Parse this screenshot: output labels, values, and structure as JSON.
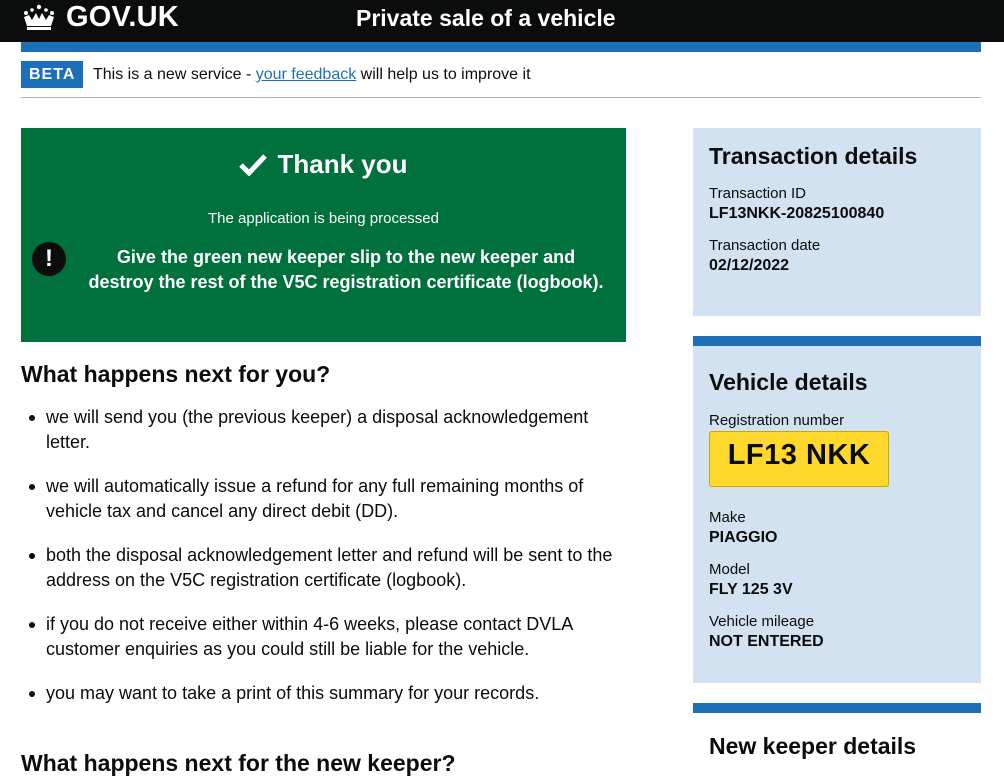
{
  "header": {
    "logo_text": "GOV.UK",
    "service_name": "Private sale of a vehicle"
  },
  "phase_banner": {
    "tag": "BETA",
    "text_before": "This is a new service - ",
    "link_text": "your feedback",
    "text_after": " will help us to improve it"
  },
  "panel": {
    "title": "Thank you",
    "subtitle": "The application is being processed",
    "warning": "Give the green new keeper slip to the new keeper and destroy the rest of the V5C registration certificate (logbook)."
  },
  "next_you": {
    "heading": "What happens next for you?",
    "items": [
      "we will send you (the previous keeper) a disposal acknowledgement letter.",
      "we will automatically issue a refund for any full remaining months of vehicle tax and cancel any direct debit (DD).",
      "both the disposal acknowledgement letter and refund will be sent to the address on the V5C registration certificate (logbook).",
      "if you do not receive either within 4-6 weeks, please contact DVLA customer enquiries as you could still be liable for the vehicle.",
      "you may want to take a print of this summary for your records."
    ]
  },
  "next_keeper": {
    "heading": "What happens next for the new keeper?"
  },
  "transaction": {
    "heading": "Transaction details",
    "id_label": "Transaction ID",
    "id_value": "LF13NKK-20825100840",
    "date_label": "Transaction date",
    "date_value": "02/12/2022"
  },
  "vehicle": {
    "heading": "Vehicle details",
    "reg_label": "Registration number",
    "reg_value": "LF13 NKK",
    "make_label": "Make",
    "make_value": "PIAGGIO",
    "model_label": "Model",
    "model_value": "FLY 125 3V",
    "mileage_label": "Vehicle mileage",
    "mileage_value": "NOT ENTERED"
  },
  "keeper": {
    "heading": "New keeper details"
  },
  "colors": {
    "header": "#0b0c0c",
    "brand_blue": "#1d70b8",
    "panel_green": "#00703c",
    "sidebar_bg": "#d2e2f1",
    "plate_yellow": "#fed92b"
  }
}
